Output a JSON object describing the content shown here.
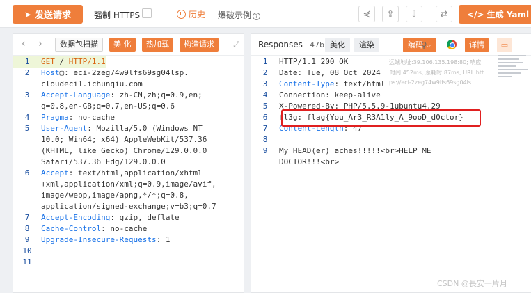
{
  "toolbar": {
    "send_label": "发送请求",
    "https_label": "强制 HTTPS",
    "history_label": "历史",
    "burst_label": "爆破示例",
    "yaml_label": "</> 生成 Yaml 模板"
  },
  "request_panel": {
    "tags": [
      "数据包扫描",
      "美 化",
      "热加载",
      "构造请求"
    ],
    "lines": [
      {
        "n": "1",
        "parts": [
          {
            "c": "m",
            "t": "GET"
          },
          {
            "c": "",
            "t": " / "
          },
          {
            "c": "m",
            "t": "HTTP/1.1"
          }
        ]
      },
      {
        "n": "2",
        "parts": [
          {
            "c": "k",
            "t": "Host"
          },
          {
            "c": "",
            "t": "▢: eci-2zeg74w9lfs69sg04lsp."
          }
        ]
      },
      {
        "n": "",
        "parts": [
          {
            "c": "",
            "t": "cloudeci1.ichunqiu.com"
          }
        ]
      },
      {
        "n": "3",
        "parts": [
          {
            "c": "k",
            "t": "Accept-Language"
          },
          {
            "c": "",
            "t": ": zh-CN,zh;q=0.9,en;"
          }
        ]
      },
      {
        "n": "",
        "parts": [
          {
            "c": "",
            "t": "q=0.8,en-GB;q=0.7,en-US;q=0.6"
          }
        ]
      },
      {
        "n": "4",
        "parts": [
          {
            "c": "k",
            "t": "Pragma"
          },
          {
            "c": "",
            "t": ": no-cache"
          }
        ]
      },
      {
        "n": "5",
        "parts": [
          {
            "c": "k",
            "t": "User-Agent"
          },
          {
            "c": "",
            "t": ": Mozilla/5.0 (Windows NT"
          }
        ]
      },
      {
        "n": "",
        "parts": [
          {
            "c": "",
            "t": "10.0; Win64; x64) AppleWebKit/537.36"
          }
        ]
      },
      {
        "n": "",
        "parts": [
          {
            "c": "",
            "t": "(KHTML, like Gecko) Chrome/129.0.0.0"
          }
        ]
      },
      {
        "n": "",
        "parts": [
          {
            "c": "",
            "t": "Safari/537.36 Edg/129.0.0.0"
          }
        ]
      },
      {
        "n": "6",
        "parts": [
          {
            "c": "k",
            "t": "Accept"
          },
          {
            "c": "",
            "t": ": text/html,application/xhtml"
          }
        ]
      },
      {
        "n": "",
        "parts": [
          {
            "c": "",
            "t": "+xml,application/xml;q=0.9,image/avif,"
          }
        ]
      },
      {
        "n": "",
        "parts": [
          {
            "c": "",
            "t": "image/webp,image/apng,*/*;q=0.8,"
          }
        ]
      },
      {
        "n": "",
        "parts": [
          {
            "c": "",
            "t": "application/signed-exchange;v=b3;q=0.7"
          }
        ]
      },
      {
        "n": "7",
        "parts": [
          {
            "c": "k",
            "t": "Accept-Encoding"
          },
          {
            "c": "",
            "t": ": gzip, deflate"
          }
        ]
      },
      {
        "n": "8",
        "parts": [
          {
            "c": "k",
            "t": "Cache-Control"
          },
          {
            "c": "",
            "t": ": no-cache"
          }
        ]
      },
      {
        "n": "9",
        "parts": [
          {
            "c": "k",
            "t": "Upgrade-Insecure-Requests"
          },
          {
            "c": "",
            "t": ": 1"
          }
        ]
      },
      {
        "n": "10",
        "parts": [
          {
            "c": "",
            "t": ""
          }
        ]
      },
      {
        "n": "11",
        "parts": [
          {
            "c": "",
            "t": ""
          }
        ]
      }
    ]
  },
  "response_panel": {
    "title": "Responses",
    "size": "47b",
    "beautify": "美化",
    "render": "渲染",
    "encoding": "编码 ⌵",
    "detail": "详情",
    "remote_addr": "远端地址:39.106.135.198:80; 响应",
    "time_info": "时间:452ms; 总耗时:87ms; URL:htt",
    "url_info": "ps://eci-2zeg74w9lfs69sg04ls...",
    "lines": [
      {
        "n": "1",
        "parts": [
          {
            "c": "",
            "t": "HTTP/1.1 200 OK"
          }
        ]
      },
      {
        "n": "2",
        "parts": [
          {
            "c": "",
            "t": "Date: Tue, 08 Oct 2024"
          }
        ]
      },
      {
        "n": "3",
        "parts": [
          {
            "c": "k",
            "t": "Content-Type"
          },
          {
            "c": "",
            "t": ": text/html"
          }
        ]
      },
      {
        "n": "4",
        "parts": [
          {
            "c": "",
            "t": "Connection: keep-alive"
          }
        ]
      },
      {
        "n": "5",
        "parts": [
          {
            "c": "",
            "t": "X-Powered-By: PHP/5.5.9-1ubuntu4.29"
          }
        ]
      },
      {
        "n": "6",
        "parts": [
          {
            "c": "",
            "t": "fl3g: flag{You_Ar3_R3A1ly_A_9ooD_d0ctor}"
          }
        ]
      },
      {
        "n": "7",
        "parts": [
          {
            "c": "k",
            "t": "Content-Length"
          },
          {
            "c": "",
            "t": ": 47"
          }
        ]
      },
      {
        "n": "8",
        "parts": [
          {
            "c": "",
            "t": ""
          }
        ]
      },
      {
        "n": "9",
        "parts": [
          {
            "c": "",
            "t": "My HEAD(er) aches!!!!!<br>HELP ME"
          }
        ]
      },
      {
        "n": "",
        "parts": [
          {
            "c": "",
            "t": "DOCTOR!!!<br>"
          }
        ]
      }
    ]
  },
  "watermark": "CSDN @長安一片月",
  "colors": {
    "accent": "#ef7e3b",
    "highlight_box": "#e02020"
  }
}
